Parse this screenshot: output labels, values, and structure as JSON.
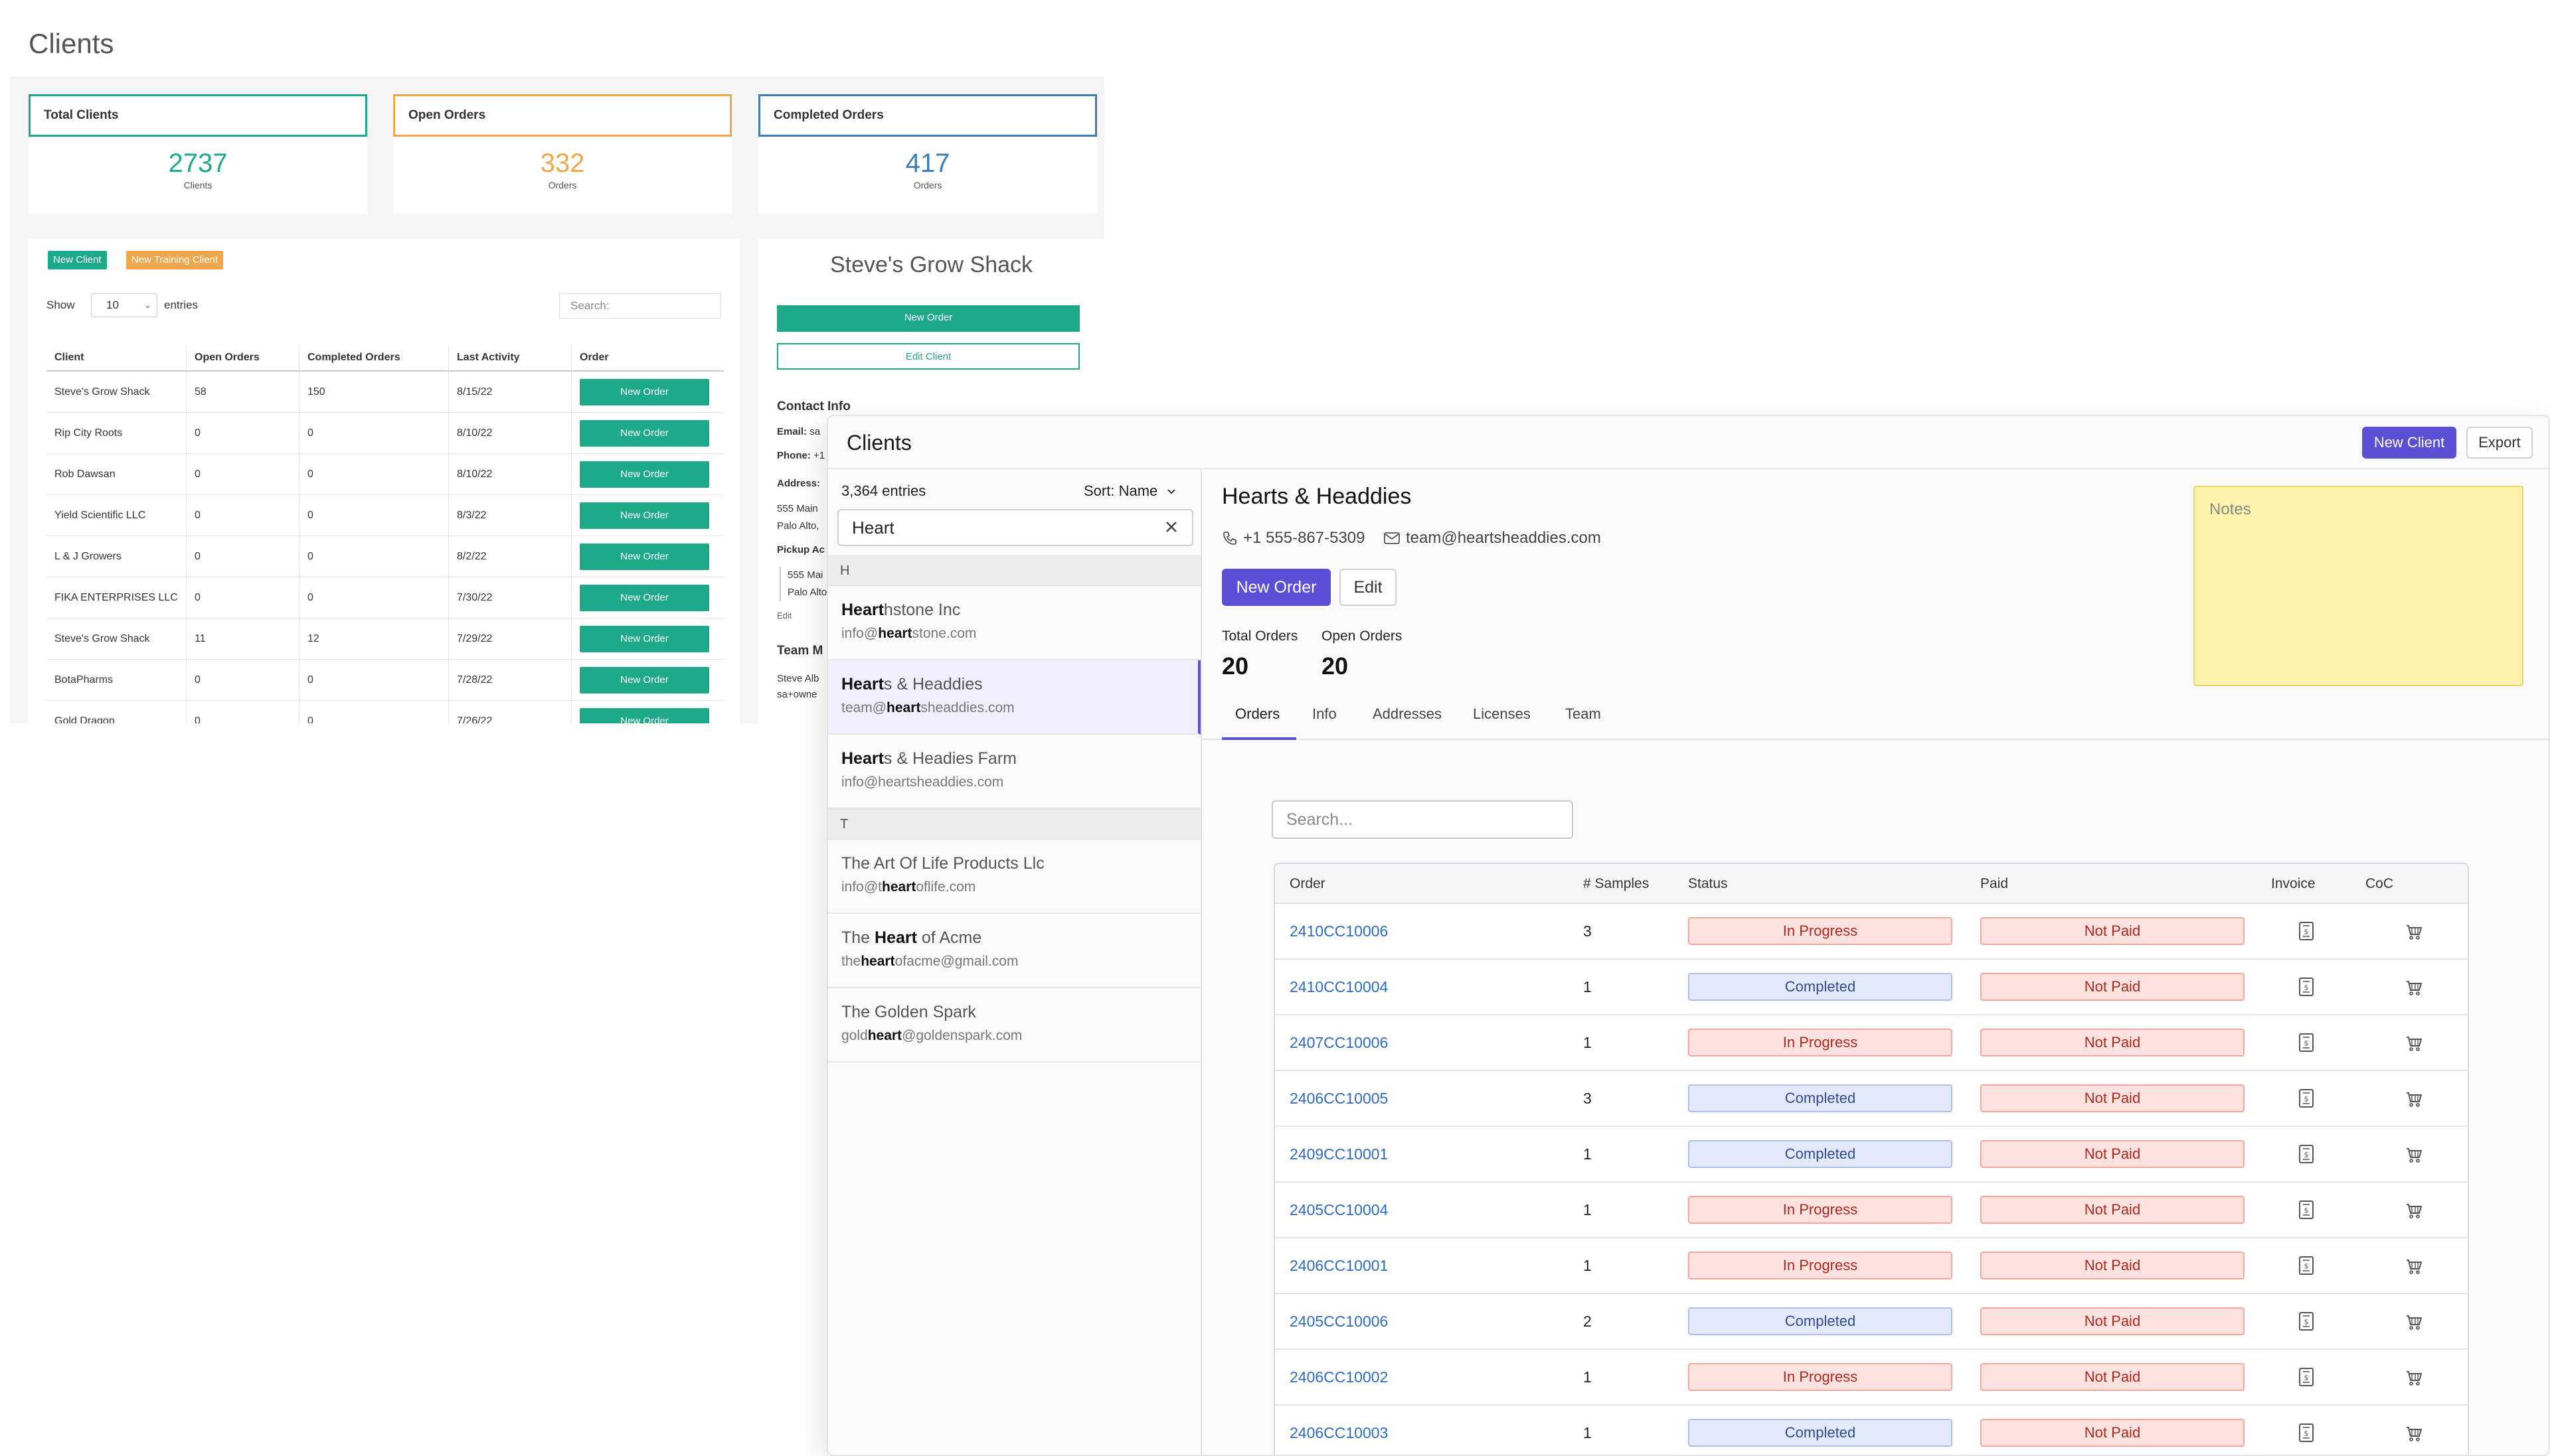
{
  "old_app": {
    "page_title": "Clients",
    "stats": [
      {
        "label": "Total Clients",
        "value": "2737",
        "sub": "Clients",
        "color": "#1eaa8a"
      },
      {
        "label": "Open Orders",
        "value": "332",
        "sub": "Orders",
        "color": "#f0a64a"
      },
      {
        "label": "Completed Orders",
        "value": "417",
        "sub": "Orders",
        "color": "#3d7eb8"
      }
    ],
    "buttons": {
      "new_client": "New Client",
      "new_training_client": "New Training Client"
    },
    "show": "Show",
    "entries_value": "10",
    "entries_label": "entries",
    "search_placeholder": "Search:",
    "table": {
      "headers": [
        "Client",
        "Open Orders",
        "Completed Orders",
        "Last Activity",
        "Order"
      ],
      "rows": [
        {
          "client": "Steve's Grow Shack",
          "open": "58",
          "completed": "150",
          "last": "8/15/22",
          "action": "New Order"
        },
        {
          "client": "Rip City Roots",
          "open": "0",
          "completed": "0",
          "last": "8/10/22",
          "action": "New Order"
        },
        {
          "client": "Rob Dawsan",
          "open": "0",
          "completed": "0",
          "last": "8/10/22",
          "action": "New Order"
        },
        {
          "client": "Yield Scientific LLC",
          "open": "0",
          "completed": "0",
          "last": "8/3/22",
          "action": "New Order"
        },
        {
          "client": "L & J Growers",
          "open": "0",
          "completed": "0",
          "last": "8/2/22",
          "action": "New Order"
        },
        {
          "client": "FIKA ENTERPRISES LLC",
          "open": "0",
          "completed": "0",
          "last": "7/30/22",
          "action": "New Order"
        },
        {
          "client": "Steve's Grow Shack",
          "open": "11",
          "completed": "12",
          "last": "7/29/22",
          "action": "New Order"
        },
        {
          "client": "BotaPharms",
          "open": "0",
          "completed": "0",
          "last": "7/28/22",
          "action": "New Order"
        },
        {
          "client": "Gold Dragon",
          "open": "0",
          "completed": "0",
          "last": "7/26/22",
          "action": "New Order"
        }
      ]
    },
    "detail": {
      "name": "Steve's Grow Shack",
      "new_order": "New Order",
      "edit_client": "Edit Client",
      "contact_info": "Contact Info",
      "email_label": "Email:",
      "email_value": "sa",
      "phone_label": "Phone:",
      "phone_value": "+1",
      "address_label": "Address:",
      "address_1": "555 Main",
      "address_2": "Palo Alto,",
      "pickup_label": "Pickup Ac",
      "pickup_1": "555 Mai",
      "pickup_2": "Palo Alto",
      "edit_link": "Edit",
      "team_label": "Team M",
      "team_1": "Steve Alb",
      "team_2": "sa+owne"
    }
  },
  "app": {
    "title": "Clients",
    "new_client": "New Client",
    "export": "Export",
    "accent": "#5b4fd6",
    "sidebar": {
      "count": "3,364 entries",
      "sort": "Sort: Name",
      "search_value": "Heart",
      "sections": [
        {
          "letter": "H",
          "items": [
            {
              "pre": "",
              "match": "Heart",
              "post": "hstone Inc",
              "epre": "info@",
              "ematch": "heart",
              "epost": "stone.com",
              "active": false
            },
            {
              "pre": "",
              "match": "Heart",
              "post": "s & Headdies",
              "epre": "team@",
              "ematch": "heart",
              "epost": "sheaddies.com",
              "active": true
            },
            {
              "pre": "",
              "match": "Heart",
              "post": "s & Headies Farm",
              "epre": "info@heartsheaddies.com",
              "ematch": "",
              "epost": "",
              "active": false
            }
          ]
        },
        {
          "letter": "T",
          "items": [
            {
              "pre": "The Art Of Life Products Llc",
              "match": "",
              "post": "",
              "epre": "info@t",
              "ematch": "heart",
              "epost": "oflife.com",
              "active": false
            },
            {
              "pre": "The ",
              "match": "Heart",
              "post": " of Acme",
              "epre": "the",
              "ematch": "heart",
              "epost": "ofacme@gmail.com",
              "active": false
            },
            {
              "pre": "The Golden Spark",
              "match": "",
              "post": "",
              "epre": "gold",
              "ematch": "heart",
              "epost": "@goldenspark.com",
              "active": false
            }
          ]
        }
      ]
    },
    "client": {
      "name": "Hearts & Headdies",
      "phone": "+1 555-867-5309",
      "email": "team@heartsheaddies.com",
      "new_order": "New Order",
      "edit": "Edit",
      "total_orders_label": "Total Orders",
      "total_orders": "20",
      "open_orders_label": "Open Orders",
      "open_orders": "20",
      "notes_placeholder": "Notes"
    },
    "tabs": [
      "Orders",
      "Info",
      "Addresses",
      "Licenses",
      "Team"
    ],
    "orders_search_placeholder": "Search...",
    "orders_headers": [
      "Order",
      "# Samples",
      "Status",
      "Paid",
      "Invoice",
      "CoC"
    ],
    "orders": [
      {
        "id": "2410CC10006",
        "samples": "3",
        "status": "In Progress",
        "paid": "Not Paid"
      },
      {
        "id": "2410CC10004",
        "samples": "1",
        "status": "Completed",
        "paid": "Not Paid"
      },
      {
        "id": "2407CC10006",
        "samples": "1",
        "status": "In Progress",
        "paid": "Not Paid"
      },
      {
        "id": "2406CC10005",
        "samples": "3",
        "status": "Completed",
        "paid": "Not Paid"
      },
      {
        "id": "2409CC10001",
        "samples": "1",
        "status": "Completed",
        "paid": "Not Paid"
      },
      {
        "id": "2405CC10004",
        "samples": "1",
        "status": "In Progress",
        "paid": "Not Paid"
      },
      {
        "id": "2406CC10001",
        "samples": "1",
        "status": "In Progress",
        "paid": "Not Paid"
      },
      {
        "id": "2405CC10006",
        "samples": "2",
        "status": "Completed",
        "paid": "Not Paid"
      },
      {
        "id": "2406CC10002",
        "samples": "1",
        "status": "In Progress",
        "paid": "Not Paid"
      },
      {
        "id": "2406CC10003",
        "samples": "1",
        "status": "Completed",
        "paid": "Not Paid"
      }
    ]
  }
}
